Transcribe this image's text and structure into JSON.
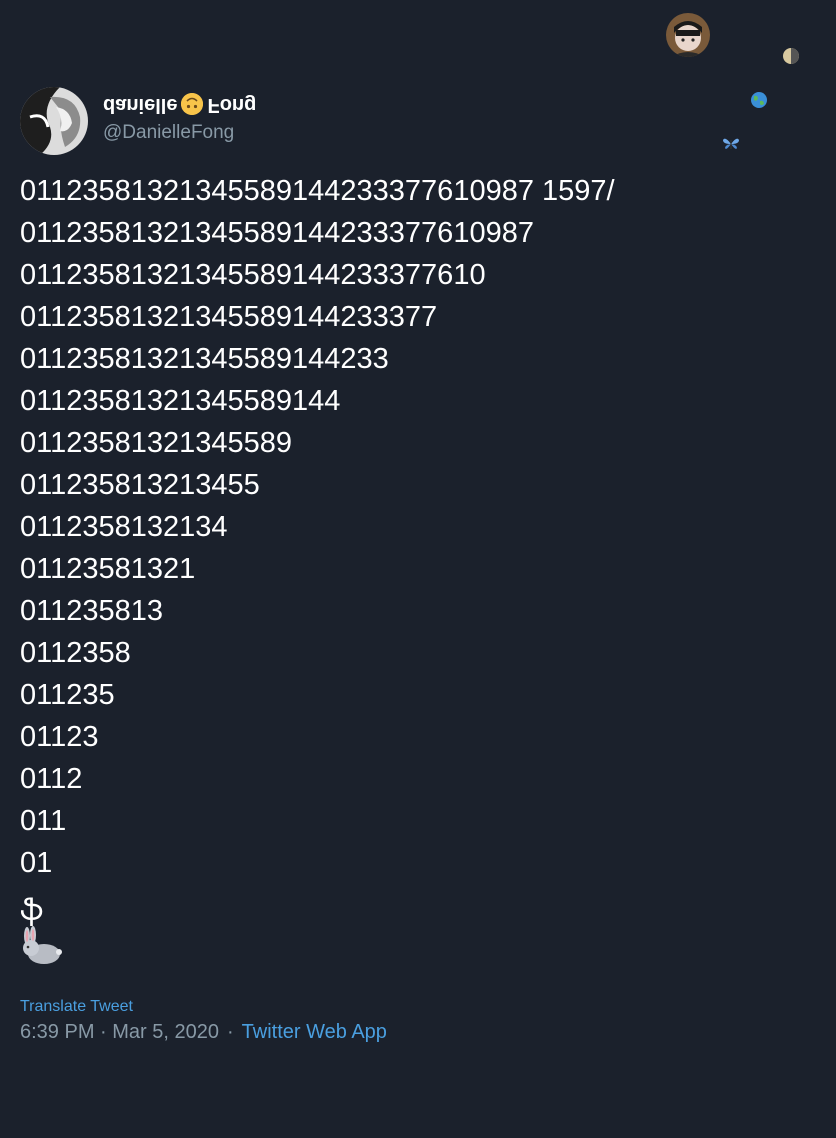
{
  "decorations": {
    "moon_icon": "moon-icon",
    "globe_icon": "globe-icon",
    "butterfly_icon": "butterfly-icon"
  },
  "author": {
    "display_name_left": "danielle",
    "display_name_emoji": "upside-down-face-icon",
    "display_name_right": "Fong",
    "handle": "@DanielleFong"
  },
  "tweet": {
    "lines": [
      "01123581321345589144233377610987 1597/",
      "01123581321345589144233377610987",
      "01123581321345589144233377610",
      "01123581321345589144233377",
      "01123581321345589144233",
      "01123581321345589144",
      "01123581321345589",
      "011235813213455",
      "0112358132134",
      "01123581321",
      "011235813",
      "0112358",
      "011235",
      "01123",
      "0112",
      "011",
      "01"
    ],
    "caret": "ֆ",
    "trailing_emoji": "rabbit-icon"
  },
  "footer": {
    "translate": "Translate Tweet",
    "time": "6:39 PM · Mar 5, 2020",
    "separator": "·",
    "app": "Twitter Web App"
  },
  "colors": {
    "background": "#1b212c",
    "text": "#ffffff",
    "secondary": "#8899a6",
    "link": "#4a9fe0"
  }
}
